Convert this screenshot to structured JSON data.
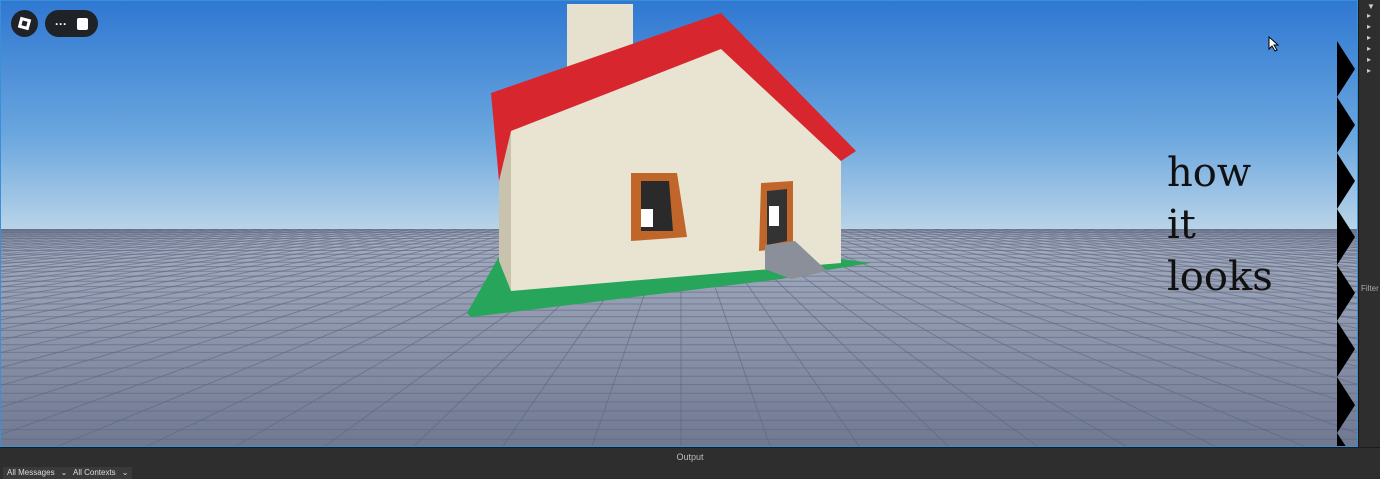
{
  "viewport": {
    "caption_lines": [
      "how",
      "it",
      "looks"
    ]
  },
  "toolbar": {
    "roblox_icon": "roblox-logo-icon",
    "more_icon": "ellipsis-icon",
    "chat_icon": "chat-icon",
    "more_label": "···"
  },
  "explorer": {
    "filter_label": "Filter"
  },
  "output": {
    "title": "Output",
    "message_filter": "All Messages",
    "context_filter": "All Contexts"
  },
  "colors": {
    "roof": "#d8262f",
    "wall": "#e9e4d2",
    "base": "#27a55a",
    "trim": "#c0662a",
    "accent": "#3a8fd6"
  }
}
